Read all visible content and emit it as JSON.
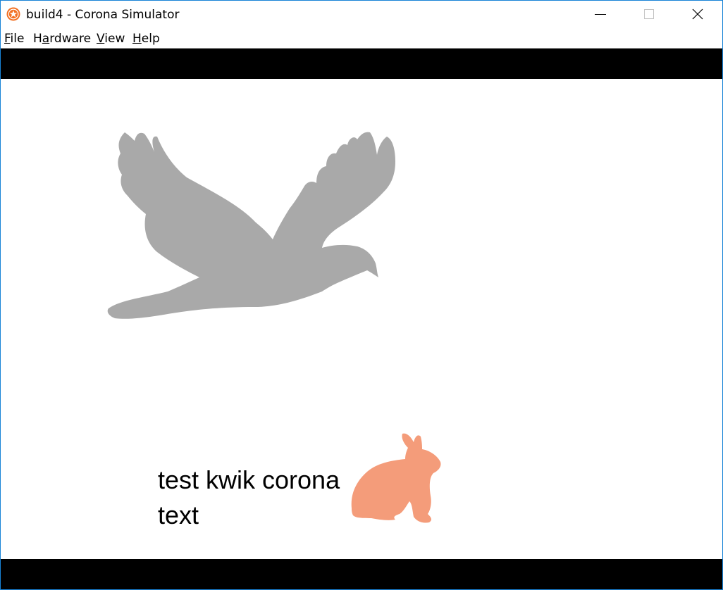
{
  "window": {
    "title": "build4 - Corona Simulator",
    "icon": "corona-app-icon",
    "border_color": "#1883d7"
  },
  "window_controls": {
    "minimize_icon": "minimize-icon",
    "maximize_icon": "maximize-icon",
    "close_icon": "close-icon"
  },
  "menu": {
    "items": [
      {
        "accel": "F",
        "rest": "ile"
      },
      {
        "pre": "H",
        "accel": "a",
        "rest": "rdware"
      },
      {
        "accel": "V",
        "rest": "iew"
      },
      {
        "accel": "H",
        "rest": "elp"
      }
    ]
  },
  "stage": {
    "background": "#ffffff",
    "letterbox_color": "#000000",
    "bird": {
      "icon": "bird-silhouette",
      "color": "#a9a9a9"
    },
    "rabbit": {
      "icon": "rabbit-silhouette",
      "color": "#f49c7a"
    },
    "text": {
      "line1": "test kwik corona",
      "line2": "text"
    }
  }
}
